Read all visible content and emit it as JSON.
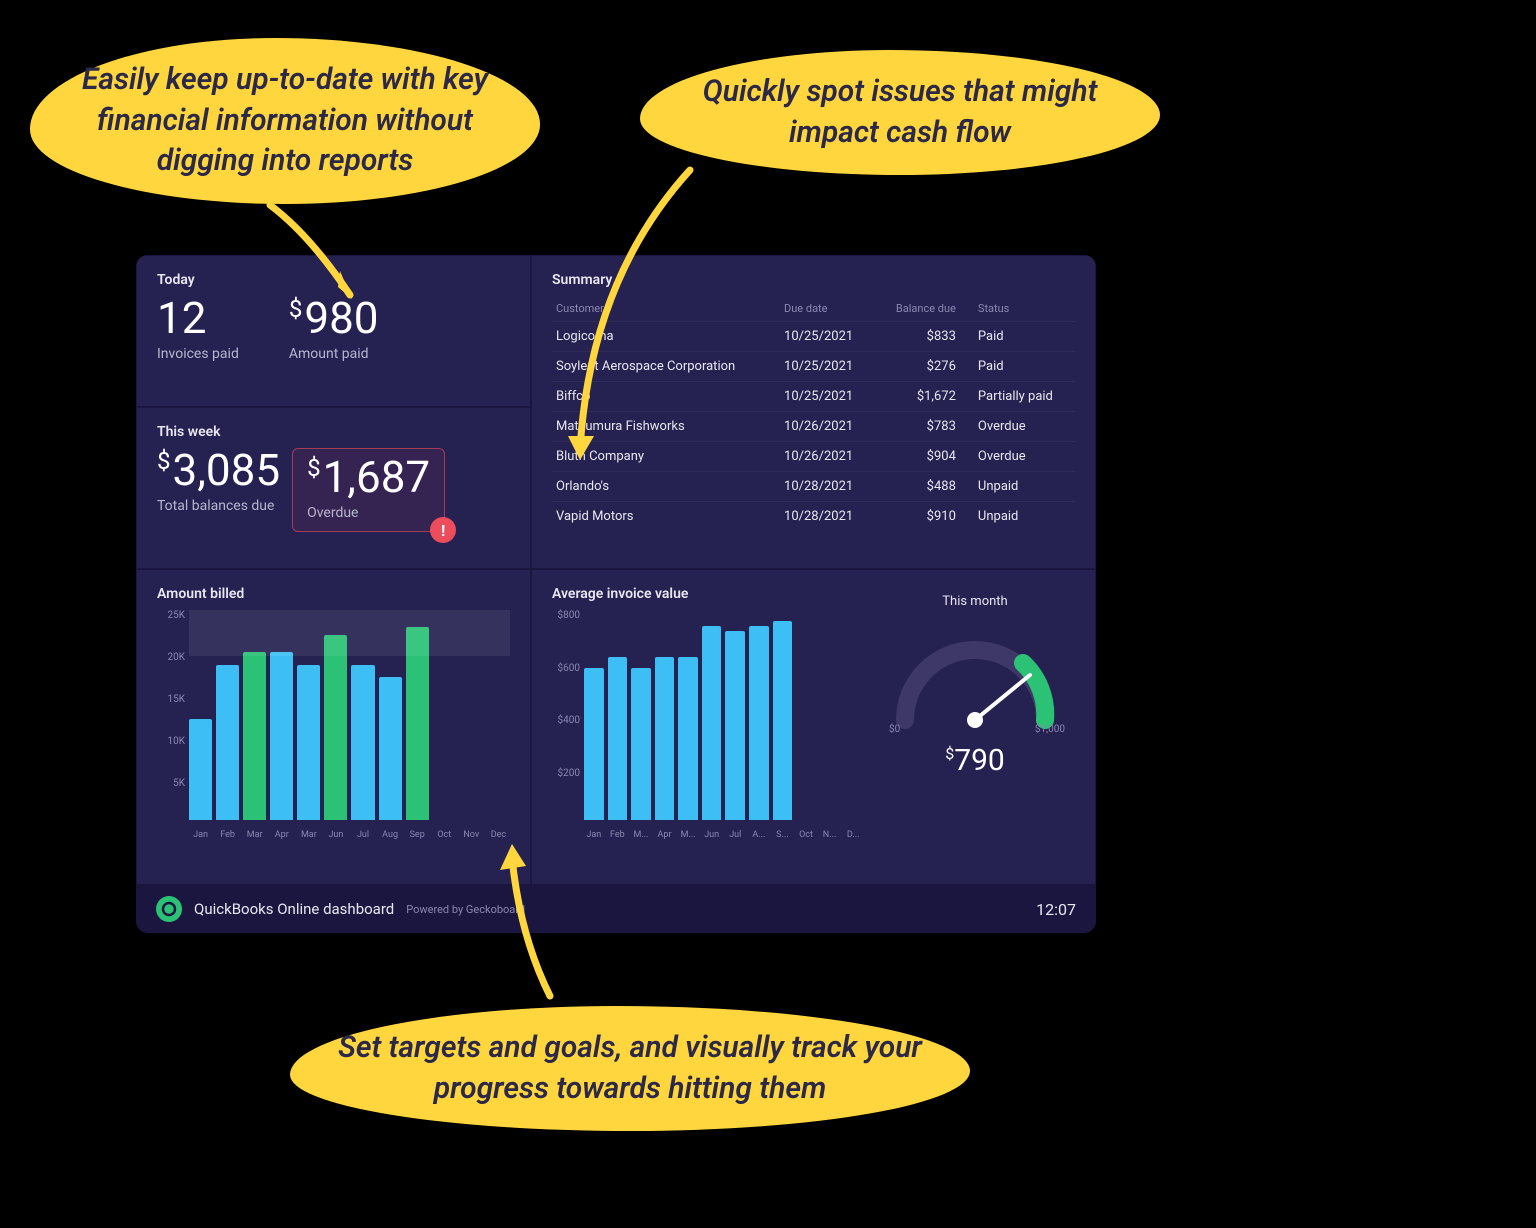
{
  "callouts": {
    "c1": "Easily keep up-to-date with key financial information without digging into reports",
    "c2": "Quickly spot issues that might impact cash flow",
    "c3": "Set targets and goals, and visually track your progress towards hitting them"
  },
  "today": {
    "title": "Today",
    "invoices_value": "12",
    "invoices_label": "Invoices paid",
    "amount_value": "980",
    "amount_label": "Amount paid"
  },
  "thisweek": {
    "title": "This week",
    "balances_value": "3,085",
    "balances_label": "Total balances due",
    "overdue_value": "1,687",
    "overdue_label": "Overdue"
  },
  "summary": {
    "title": "Summary",
    "headers": [
      "Customer",
      "Due date",
      "Balance due",
      "Status"
    ],
    "rows": [
      {
        "customer": "Logicoma",
        "due": "10/25/2021",
        "balance": "$833",
        "status": "Paid"
      },
      {
        "customer": "Soylent Aerospace Corporation",
        "due": "10/25/2021",
        "balance": "$276",
        "status": "Paid"
      },
      {
        "customer": "Biffco",
        "due": "10/25/2021",
        "balance": "$1,672",
        "status": "Partially paid"
      },
      {
        "customer": "Matsumura Fishworks",
        "due": "10/26/2021",
        "balance": "$783",
        "status": "Overdue"
      },
      {
        "customer": "Bluth Company",
        "due": "10/26/2021",
        "balance": "$904",
        "status": "Overdue"
      },
      {
        "customer": "Orlando's",
        "due": "10/28/2021",
        "balance": "$488",
        "status": "Unpaid"
      },
      {
        "customer": "Vapid Motors",
        "due": "10/28/2021",
        "balance": "$910",
        "status": "Unpaid"
      }
    ]
  },
  "billed": {
    "title": "Amount billed"
  },
  "avginvoice": {
    "title": "Average invoice value",
    "gauge_title": "This month",
    "gauge_min": "$0",
    "gauge_max": "$1,000",
    "gauge_value": "790"
  },
  "footer": {
    "title": "QuickBooks Online dashboard",
    "sub": "Powered by Geckoboard",
    "clock": "12:07"
  },
  "chart_data": [
    {
      "type": "bar",
      "title": "Amount billed",
      "ylabel": "",
      "ylim": [
        0,
        25000
      ],
      "yticks": [
        "25K",
        "20K",
        "15K",
        "10K",
        "5K",
        ""
      ],
      "categories": [
        "Jan",
        "Feb",
        "Mar",
        "Apr",
        "Mar",
        "Jun",
        "Jul",
        "Aug",
        "Sep",
        "Oct",
        "Nov",
        "Dec"
      ],
      "values": [
        12000,
        18500,
        20000,
        20000,
        18500,
        22000,
        18500,
        17000,
        23000,
        0,
        0,
        0
      ],
      "colors": [
        "blue",
        "blue",
        "green",
        "blue",
        "blue",
        "green",
        "blue",
        "blue",
        "green",
        "empty",
        "empty",
        "empty"
      ],
      "goal_band": [
        19500,
        25000
      ]
    },
    {
      "type": "bar",
      "title": "Average invoice value",
      "ylabel": "",
      "ylim": [
        0,
        800
      ],
      "yticks": [
        "$800",
        "$600",
        "$400",
        "$200",
        ""
      ],
      "categories": [
        "Jan",
        "Feb",
        "M...",
        "Apr",
        "M...",
        "Jun",
        "Jul",
        "A...",
        "S...",
        "Oct",
        "N...",
        "D..."
      ],
      "values": [
        580,
        620,
        580,
        620,
        620,
        740,
        720,
        740,
        760,
        0,
        0,
        0
      ]
    },
    {
      "type": "gauge",
      "title": "This month",
      "min": 0,
      "max": 1000,
      "value": 790,
      "target_band": [
        700,
        1000
      ]
    }
  ]
}
